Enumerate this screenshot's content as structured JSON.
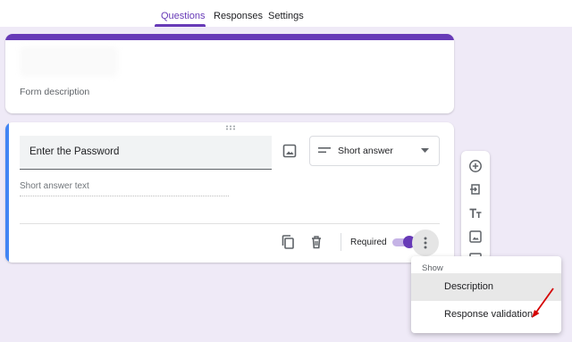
{
  "tabs": [
    {
      "label": "Questions",
      "active": true
    },
    {
      "label": "Responses",
      "active": false
    },
    {
      "label": "Settings",
      "active": false
    }
  ],
  "header_card": {
    "description_placeholder": "Form description"
  },
  "question": {
    "title": "Enter the Password",
    "type_label": "Short answer",
    "answer_placeholder": "Short answer text",
    "required_label": "Required",
    "required_on": true
  },
  "side_toolbar": {
    "icons": [
      "add-question-icon",
      "import-questions-icon",
      "add-title-icon",
      "add-image-icon",
      "add-video-icon"
    ]
  },
  "more_menu": {
    "header": "Show",
    "items": [
      {
        "label": "Description",
        "highlighted": true
      },
      {
        "label": "Response validation",
        "highlighted": false
      }
    ]
  },
  "colors": {
    "accent": "#673ab7",
    "question_bar": "#4285f4",
    "background": "#efeaf7",
    "annotation_arrow": "#d50000"
  }
}
